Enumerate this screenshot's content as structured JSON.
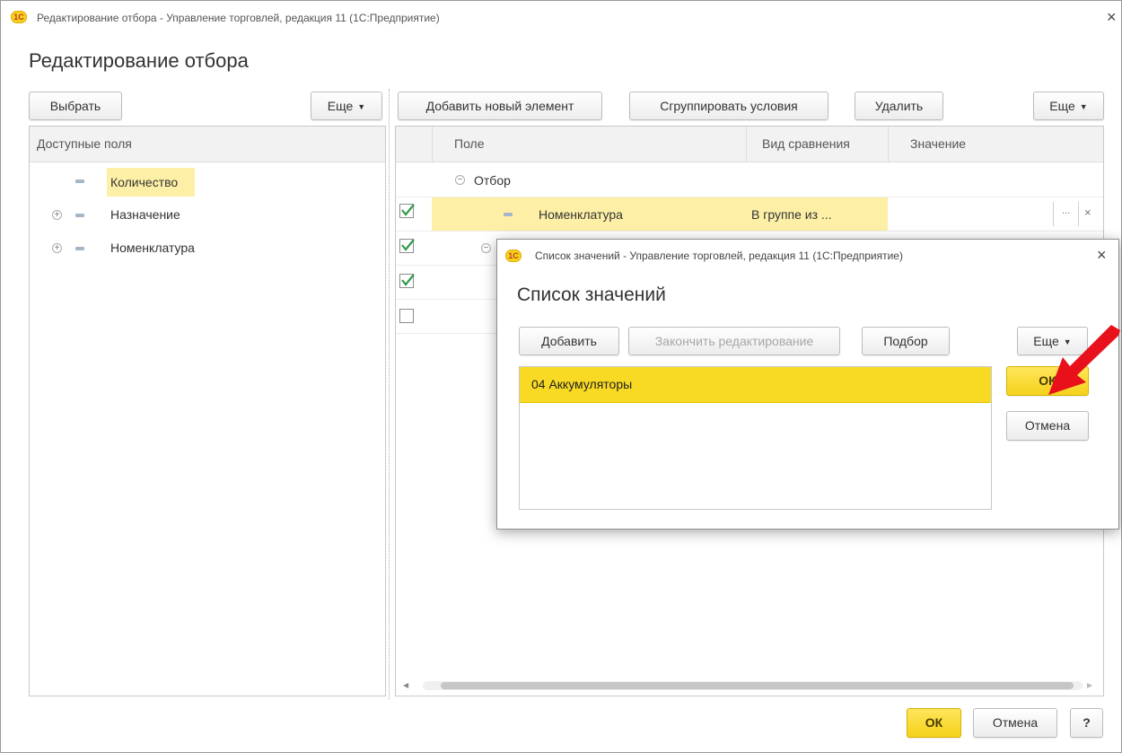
{
  "window": {
    "title": "Редактирование отбора - Управление торговлей, редакция 11  (1С:Предприятие)",
    "logo": "1С",
    "heading": "Редактирование отбора",
    "close_icon": "×"
  },
  "left_toolbar": {
    "choose_label": "Выбрать",
    "more_label": "Еще"
  },
  "right_toolbar": {
    "add_label": "Добавить новый элемент",
    "group_label": "Сгруппировать условия",
    "delete_label": "Удалить",
    "more_label": "Еще"
  },
  "fields_panel": {
    "header": "Доступные поля",
    "items": [
      {
        "label": "Количество",
        "expandable": false,
        "selected": true
      },
      {
        "label": "Назначение",
        "expandable": true,
        "selected": false
      },
      {
        "label": "Номенклатура",
        "expandable": true,
        "selected": false
      }
    ]
  },
  "filter_table": {
    "columns": [
      "Поле",
      "Вид сравнения",
      "Значение"
    ],
    "group_label": "Отбор",
    "rows": [
      {
        "checked": true,
        "field": "Номенклатура",
        "comparison": "В группе из ...",
        "value": ""
      },
      {
        "checked": true,
        "field": "",
        "comparison": "",
        "value": ""
      },
      {
        "checked": true,
        "field": "",
        "comparison": "",
        "value": ""
      },
      {
        "checked": false,
        "field": "",
        "comparison": "",
        "value": ""
      }
    ],
    "select_button": "...",
    "clear_button": "×"
  },
  "bottom": {
    "ok_label": "ОК",
    "cancel_label": "Отмена",
    "help_label": "?"
  },
  "values_dialog": {
    "title": "Список значений - Управление торговлей, редакция 11  (1С:Предприятие)",
    "heading": "Список значений",
    "add_label": "Добавить",
    "finish_label": "Закончить редактирование",
    "pick_label": "Подбор",
    "more_label": "Еще",
    "items": [
      "04 Аккумуляторы"
    ],
    "ok_label": "ОК",
    "cancel_label": "Отмена"
  },
  "colors": {
    "accent_yellow": "#f5d21a",
    "selection_yellow": "#f8da24",
    "highlight_yellow": "#fdf0a6",
    "arrow_red": "#e8101a",
    "check_green": "#2e9b4a"
  },
  "icons": [
    "logo-1c-icon",
    "close-icon",
    "caret-down-icon",
    "expand-plus-icon",
    "collapse-minus-icon",
    "field-dash-icon",
    "checkbox-icon",
    "red-arrow-annotation"
  ]
}
